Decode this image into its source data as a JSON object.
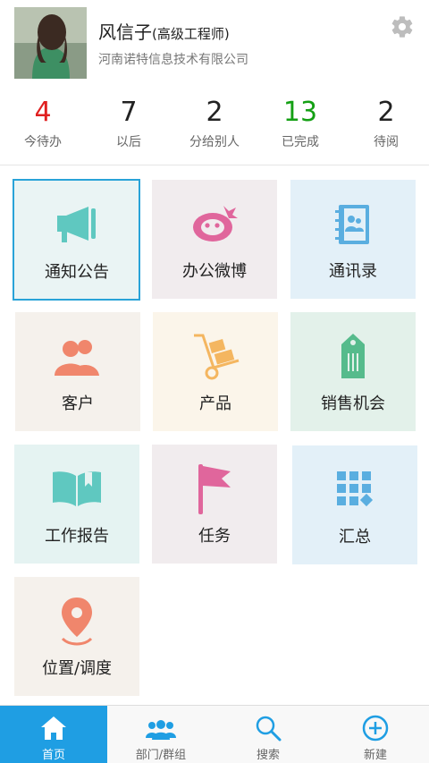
{
  "profile": {
    "name": "风信子",
    "title": "(高级工程师)",
    "company": "河南诺特信息技术有限公司"
  },
  "stats": [
    {
      "value": "4",
      "label": "今待办",
      "color": "#e02020"
    },
    {
      "value": "7",
      "label": "以后",
      "color": "#222222"
    },
    {
      "value": "2",
      "label": "分给别人",
      "color": "#222222"
    },
    {
      "value": "13",
      "label": "已完成",
      "color": "#14a014"
    },
    {
      "value": "2",
      "label": "待阅",
      "color": "#222222"
    }
  ],
  "tiles": [
    {
      "label": "通知公告",
      "icon": "megaphone-icon",
      "bg": "#eaf4f4",
      "color": "#5fc8c0"
    },
    {
      "label": "办公微博",
      "icon": "weibo-icon",
      "bg": "#f1ecee",
      "color": "#e0669c"
    },
    {
      "label": "通讯录",
      "icon": "contacts-book-icon",
      "bg": "#e3f0f8",
      "color": "#5aaee0"
    },
    {
      "label": "客户",
      "icon": "customers-icon",
      "bg": "#f5f1ec",
      "color": "#f0866c"
    },
    {
      "label": "产品",
      "icon": "hand-truck-icon",
      "bg": "#fbf5ea",
      "color": "#f4b660"
    },
    {
      "label": "销售机会",
      "icon": "price-tag-icon",
      "bg": "#e3f1ea",
      "color": "#56bb8c"
    },
    {
      "label": "工作报告",
      "icon": "open-book-icon",
      "bg": "#e5f3f2",
      "color": "#5fc8c0"
    },
    {
      "label": "任务",
      "icon": "flag-icon",
      "bg": "#f1ecee",
      "color": "#e0669c"
    },
    {
      "label": "汇总",
      "icon": "grid-summary-icon",
      "bg": "#e3f0f8",
      "color": "#5aaee0"
    },
    {
      "label": "位置/调度",
      "icon": "location-pin-icon",
      "bg": "#f5f1ec",
      "color": "#f0866c"
    }
  ],
  "nav": [
    {
      "label": "首页",
      "icon": "home-icon"
    },
    {
      "label": "部门/群组",
      "icon": "group-icon"
    },
    {
      "label": "搜索",
      "icon": "search-icon"
    },
    {
      "label": "新建",
      "icon": "add-circle-icon"
    }
  ],
  "colors": {
    "accent": "#1f9ee3",
    "selected_border": "#29a3d8"
  }
}
